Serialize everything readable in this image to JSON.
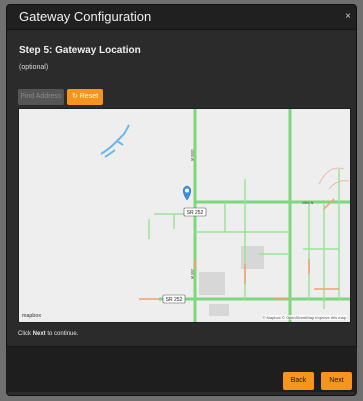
{
  "dialog": {
    "title": "Gateway Configuration",
    "close_icon": "×"
  },
  "step": {
    "title": "Step 5: Gateway Location",
    "subtitle": "(optional)"
  },
  "toolbar": {
    "disabled_button_label": "Find Address",
    "reset_label": "↻ Reset"
  },
  "map": {
    "road_labels": {
      "sr252_upper": "SR 252",
      "sr252_lower": "SR 252",
      "road_1500n_label": "1500 N",
      "road_vertical_label": "1000 W",
      "road_vertical_label_lower": "200 W"
    },
    "logo_text": "mapbox",
    "attribution": "© Mapbox © OpenStreetMap Improve this map",
    "marker_icon": "map-pin-icon"
  },
  "instructions": {
    "prefix": "Click ",
    "bold": "Next",
    "suffix": " to continue."
  },
  "footer": {
    "back_label": "Back",
    "next_label": "Next"
  },
  "colors": {
    "accent": "#f7941d",
    "road_green": "#7dd87d",
    "road_orange": "#f0a070",
    "marker": "#3b8fd9",
    "water": "#6db7e8"
  }
}
